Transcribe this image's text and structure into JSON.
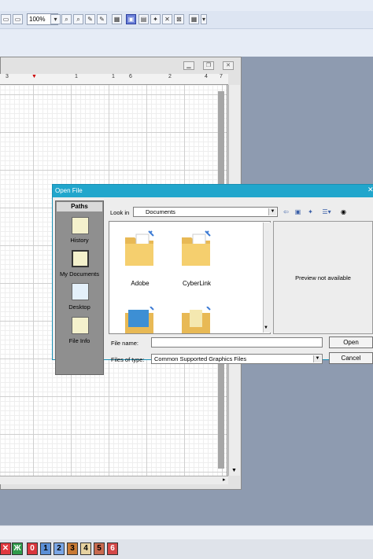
{
  "toolbar": {
    "zoom_value": "100%"
  },
  "ruler": {
    "ticks": [
      "3",
      "1",
      "1",
      "6",
      "2",
      "4",
      "7"
    ]
  },
  "dialog": {
    "title": "Open File",
    "paths": {
      "header": "Paths",
      "items": [
        {
          "label": "History"
        },
        {
          "label": "My Documents"
        },
        {
          "label": "Desktop"
        },
        {
          "label": "File Info"
        }
      ]
    },
    "look_in_label": "Look in",
    "look_in_value": "Documents",
    "files": [
      {
        "name": "Adobe"
      },
      {
        "name": "CyberLink"
      }
    ],
    "preview_text": "Preview not available",
    "file_name_label": "File name:",
    "file_name_value": "",
    "files_of_type_label": "Files of type:",
    "files_of_type_value": "Common Supported Graphics Files",
    "open_label": "Open",
    "cancel_label": "Cancel"
  },
  "layers": [
    "0",
    "1",
    "2",
    "3",
    "4",
    "5",
    "6"
  ],
  "colors": {
    "title_bar": "#21a6cc",
    "layer_0": "#d9363e",
    "layer_1": "#5b8fd6",
    "layer_2": "#7aa6e6",
    "layer_3": "#c87a35",
    "layer_4": "#e6d2a0",
    "layer_5": "#c96a4f",
    "layer_6": "#d44848"
  }
}
